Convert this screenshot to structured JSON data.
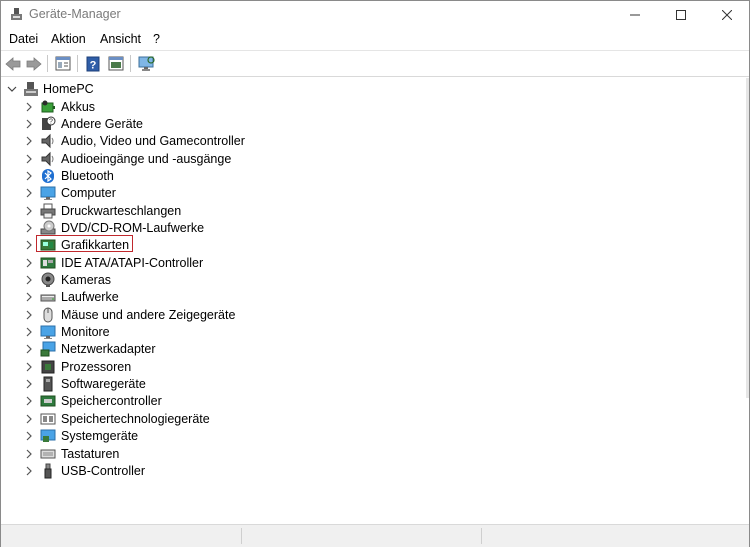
{
  "window": {
    "title": "Geräte-Manager"
  },
  "menu": [
    "Datei",
    "Aktion",
    "Ansicht",
    "?"
  ],
  "toolbar": [
    "back-icon",
    "forward-icon",
    "properties-icon",
    "help-icon",
    "update-driver-icon",
    "scan-hardware-icon"
  ],
  "tree": {
    "root": "HomePC",
    "categories": [
      {
        "label": "Akkus",
        "icon": "battery-icon"
      },
      {
        "label": "Andere Geräte",
        "icon": "unknown-device-icon"
      },
      {
        "label": "Audio, Video und Gamecontroller",
        "icon": "speaker-icon"
      },
      {
        "label": "Audioeingänge und -ausgänge",
        "icon": "speaker-icon"
      },
      {
        "label": "Bluetooth",
        "icon": "bluetooth-icon"
      },
      {
        "label": "Computer",
        "icon": "computer-icon"
      },
      {
        "label": "Druckwarteschlangen",
        "icon": "printer-icon"
      },
      {
        "label": "DVD/CD-ROM-Laufwerke",
        "icon": "disc-drive-icon"
      },
      {
        "label": "Grafikkarten",
        "icon": "display-adapter-icon",
        "highlighted": true
      },
      {
        "label": "IDE ATA/ATAPI-Controller",
        "icon": "ide-controller-icon"
      },
      {
        "label": "Kameras",
        "icon": "camera-icon"
      },
      {
        "label": "Laufwerke",
        "icon": "hard-drive-icon"
      },
      {
        "label": "Mäuse und andere Zeigegeräte",
        "icon": "mouse-icon"
      },
      {
        "label": "Monitore",
        "icon": "monitor-icon"
      },
      {
        "label": "Netzwerkadapter",
        "icon": "network-adapter-icon"
      },
      {
        "label": "Prozessoren",
        "icon": "processor-icon"
      },
      {
        "label": "Softwaregeräte",
        "icon": "software-device-icon"
      },
      {
        "label": "Speichercontroller",
        "icon": "storage-controller-icon"
      },
      {
        "label": "Speichertechnologiegeräte",
        "icon": "memory-tech-icon"
      },
      {
        "label": "Systemgeräte",
        "icon": "system-device-icon"
      },
      {
        "label": "Tastaturen",
        "icon": "keyboard-icon"
      },
      {
        "label": "USB-Controller",
        "icon": "usb-icon"
      }
    ]
  },
  "colors": {
    "highlight_border": "#c0282d",
    "title_text": "#7a7a7a"
  }
}
